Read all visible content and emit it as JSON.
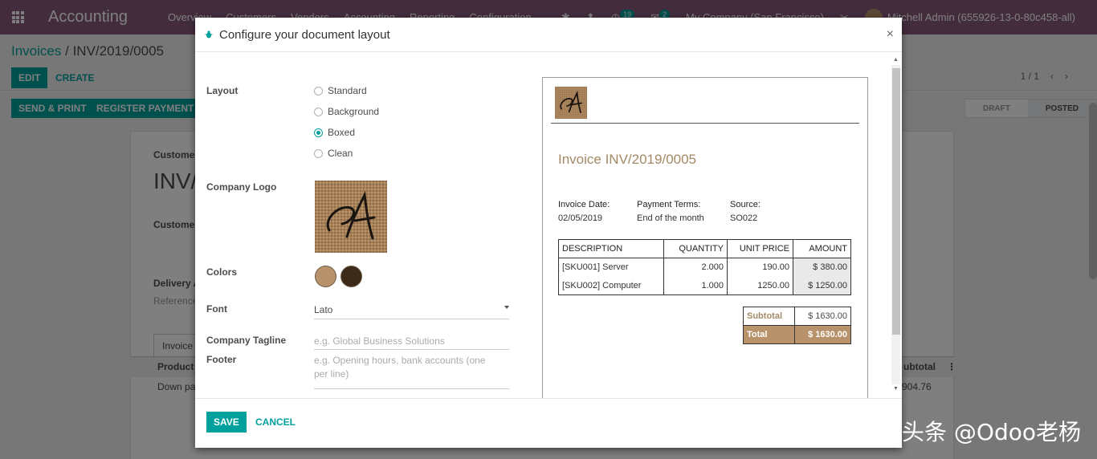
{
  "navbar": {
    "brand": "Accounting",
    "menu": [
      "Overview",
      "Customers",
      "Vendors",
      "Accounting",
      "Reporting",
      "Configuration"
    ],
    "activity_count": "19",
    "message_count": "2",
    "company": "My Company (San Francisco)",
    "user": "Mitchell Admin (655926-13-0-80c458-all)"
  },
  "control_panel": {
    "breadcrumb_parent": "Invoices",
    "breadcrumb_sep": "/",
    "breadcrumb_current": "INV/2019/0005",
    "edit_label": "EDIT",
    "create_label": "CREATE",
    "send_print_label": "SEND & PRINT",
    "register_payment_label": "REGISTER PAYMENT",
    "pager": "1 / 1",
    "status_draft": "DRAFT",
    "status_posted": "POSTED"
  },
  "sheet": {
    "customer_label": "Customer",
    "invoice_prefix": "INV/",
    "customer_field_label": "Customer",
    "delivery_label": "Delivery A",
    "reference_label": "Reference",
    "tab_invoice": "Invoice",
    "col_product": "Product",
    "col_subtotal": "ubtotal",
    "row_product": "Down pa",
    "row_subtotal": "904.76"
  },
  "modal": {
    "title": "Configure your document layout",
    "close": "×",
    "layout_label": "Layout",
    "layout_options": [
      {
        "label": "Standard",
        "checked": false
      },
      {
        "label": "Background",
        "checked": false
      },
      {
        "label": "Boxed",
        "checked": true
      },
      {
        "label": "Clean",
        "checked": false
      }
    ],
    "company_logo_label": "Company Logo",
    "colors_label": "Colors",
    "colors": [
      "#b8926a",
      "#3d2b1a"
    ],
    "font_label": "Font",
    "font_value": "Lato",
    "tagline_label": "Company Tagline",
    "tagline_placeholder": "e.g. Global Business Solutions",
    "footer_label": "Footer",
    "footer_placeholder": "e.g. Opening hours, bank accounts (one per line)",
    "save_label": "SAVE",
    "cancel_label": "CANCEL"
  },
  "preview": {
    "title": "Invoice INV/2019/0005",
    "invoice_date_label": "Invoice Date:",
    "invoice_date": "02/05/2019",
    "payment_terms_label": "Payment Terms:",
    "payment_terms": "End of the month",
    "source_label": "Source:",
    "source": "SO022",
    "columns": [
      "DESCRIPTION",
      "QUANTITY",
      "UNIT PRICE",
      "AMOUNT"
    ],
    "rows": [
      {
        "description": "[SKU001] Server",
        "quantity": "2.000",
        "unit_price": "190.00",
        "amount": "$ 380.00"
      },
      {
        "description": "[SKU002] Computer",
        "quantity": "1.000",
        "unit_price": "1250.00",
        "amount": "$ 1250.00"
      }
    ],
    "subtotal_label": "Subtotal",
    "subtotal": "$ 1630.00",
    "total_label": "Total",
    "total": "$ 1630.00"
  },
  "watermark": "头条 @Odoo老杨"
}
